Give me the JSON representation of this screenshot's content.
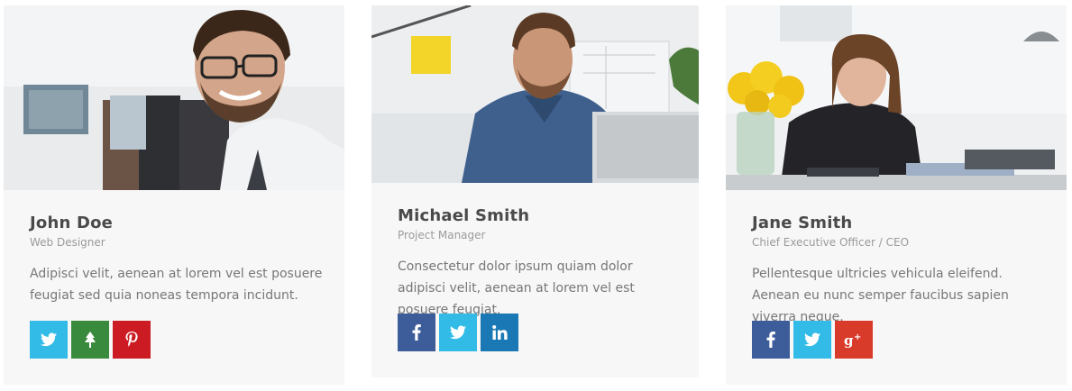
{
  "team": [
    {
      "name": "John Doe",
      "role": "Web Designer",
      "bio": "Adipisci velit, aenean at lorem vel est posuere feugiat sed quia noneas tempora incidunt.",
      "socials": [
        {
          "network": "twitter",
          "icon": "twitter-icon",
          "color": "#33bbe8"
        },
        {
          "network": "tree",
          "icon": "tree-icon",
          "color": "#3a8a3e"
        },
        {
          "network": "pinterest",
          "icon": "pinterest-icon",
          "color": "#cc1b22"
        }
      ]
    },
    {
      "name": "Michael Smith",
      "role": "Project Manager",
      "bio": "Consectetur dolor ipsum quiam dolor adipisci velit, aenean at lorem vel est posuere feugiat.",
      "socials": [
        {
          "network": "facebook",
          "icon": "facebook-icon",
          "color": "#3d5c9a"
        },
        {
          "network": "twitter",
          "icon": "twitter-icon",
          "color": "#33bbe8"
        },
        {
          "network": "linkedin",
          "icon": "linkedin-icon",
          "color": "#1a78b4"
        }
      ]
    },
    {
      "name": "Jane Smith",
      "role": "Chief Executive Officer / CEO",
      "bio": "Pellentesque ultricies vehicula eleifend. Aenean eu nunc semper faucibus sapien viverra neque.",
      "socials": [
        {
          "network": "facebook",
          "icon": "facebook-icon",
          "color": "#3d5c9a"
        },
        {
          "network": "twitter",
          "icon": "twitter-icon",
          "color": "#33bbe8"
        },
        {
          "network": "google-plus",
          "icon": "google-plus-icon",
          "color": "#d93b2b"
        }
      ]
    }
  ]
}
